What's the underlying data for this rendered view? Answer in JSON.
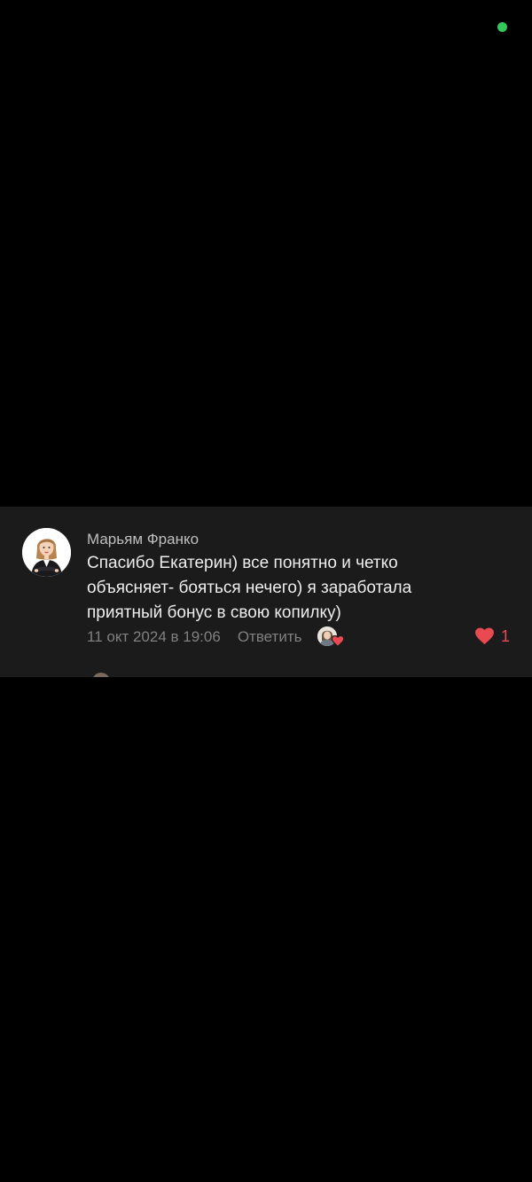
{
  "status_bar": {
    "indicator_color": "#34c759"
  },
  "comment": {
    "author": "Марьям Франко",
    "text": "Спасибо Екатерин) все понятно и четко объясняет- бояться нечего) я заработала приятный бонус в свою копилку)",
    "date": "11 окт 2024 в 19:06",
    "reply_label": "Ответить",
    "likes": "1",
    "like_color": "#e94a52",
    "avatar_icon": "woman-in-suit-avatar",
    "reactor_icon": "reactor-avatar-with-heart"
  },
  "colors": {
    "background": "#000000",
    "card": "#1b1b1b",
    "text_primary": "#ededed",
    "text_secondary": "#808080"
  }
}
